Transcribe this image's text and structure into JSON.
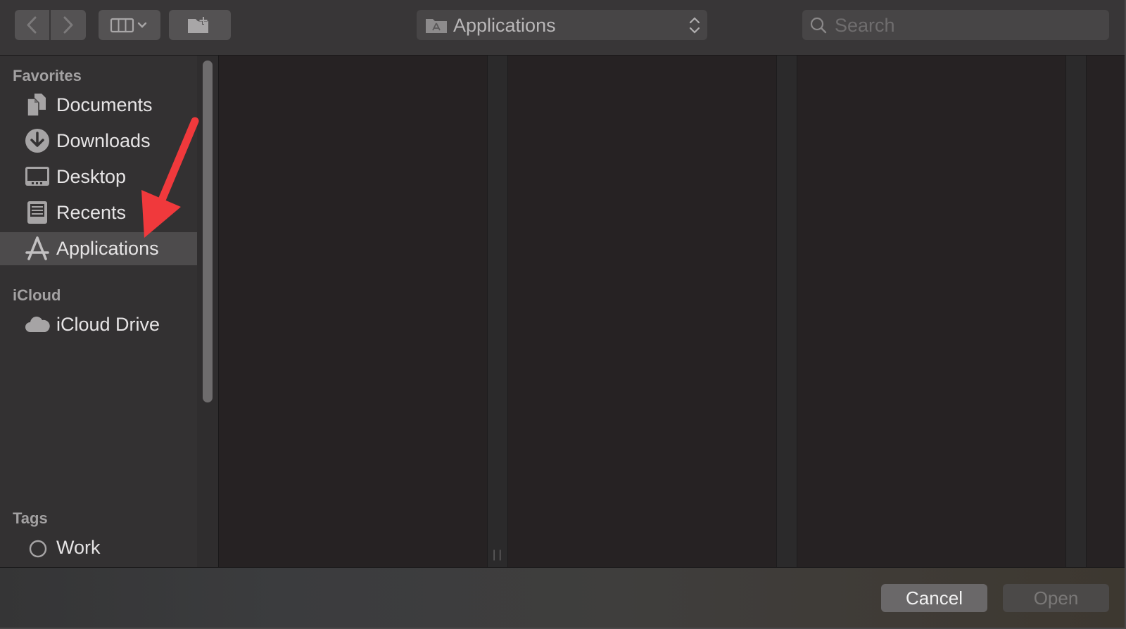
{
  "toolbar": {
    "path_label": "Applications",
    "search_placeholder": "Search"
  },
  "sidebar": {
    "favorites_title": "Favorites",
    "favorites": [
      {
        "label": "Documents",
        "icon": "documents-icon"
      },
      {
        "label": "Downloads",
        "icon": "downloads-icon"
      },
      {
        "label": "Desktop",
        "icon": "desktop-icon"
      },
      {
        "label": "Recents",
        "icon": "recents-icon"
      },
      {
        "label": "Applications",
        "icon": "applications-icon",
        "selected": true
      }
    ],
    "icloud_title": "iCloud",
    "icloud": [
      {
        "label": "iCloud Drive",
        "icon": "cloud-icon"
      }
    ],
    "tags_title": "Tags",
    "tags": [
      {
        "label": "Work",
        "icon": "tag-circle-icon"
      }
    ]
  },
  "buttons": {
    "cancel": "Cancel",
    "open": "Open"
  },
  "colors": {
    "annotation_arrow": "#f0393c",
    "selected_row": "#4d4b4c"
  }
}
